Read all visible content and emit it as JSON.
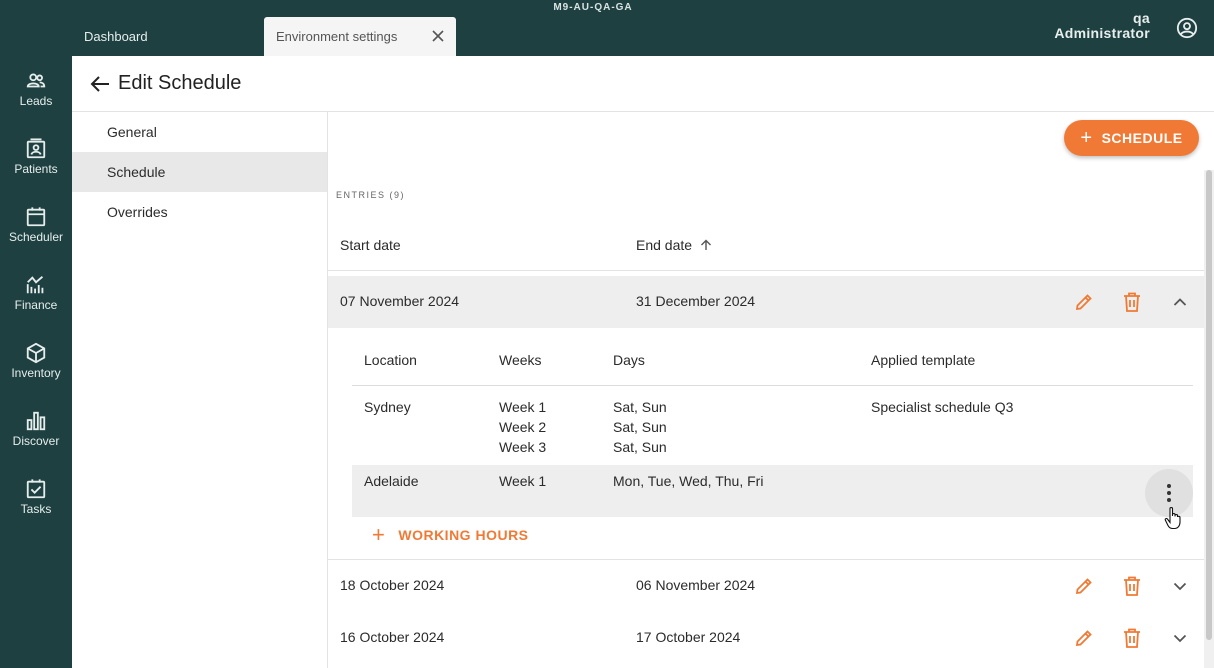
{
  "topbar": {
    "env_code": "M9-AU-QA-GA",
    "tabs": [
      {
        "label": "Dashboard"
      },
      {
        "label": "Environment settings"
      }
    ],
    "user": {
      "line1": "qa",
      "line2": "Administrator"
    },
    "icons": {
      "close": "close-icon",
      "user": "user-circle-icon"
    }
  },
  "sidebar": {
    "items": [
      {
        "label": "Leads",
        "icon": "people-icon"
      },
      {
        "label": "Patients",
        "icon": "contact-card-icon"
      },
      {
        "label": "Scheduler",
        "icon": "calendar-icon"
      },
      {
        "label": "Finance",
        "icon": "chart-line-icon"
      },
      {
        "label": "Inventory",
        "icon": "box-icon"
      },
      {
        "label": "Discover",
        "icon": "bar-chart-icon"
      },
      {
        "label": "Tasks",
        "icon": "task-check-icon"
      }
    ]
  },
  "header": {
    "title": "Edit Schedule",
    "back_icon": "arrow-left-icon"
  },
  "left_menu": {
    "items": [
      {
        "label": "General",
        "active": false
      },
      {
        "label": "Schedule",
        "active": true
      },
      {
        "label": "Overrides",
        "active": false
      }
    ]
  },
  "main": {
    "add_button": {
      "plus": "+",
      "label": "SCHEDULE"
    },
    "entries_label": "ENTRIES (9)",
    "columns": {
      "start": "Start date",
      "end": "End date"
    },
    "rows": [
      {
        "start": "07 November 2024",
        "end": "31 December 2024",
        "expanded": true
      },
      {
        "start": "18 October 2024",
        "end": "06 November 2024",
        "expanded": false
      },
      {
        "start": "16 October 2024",
        "end": "17 October 2024",
        "expanded": false
      }
    ],
    "detail": {
      "headers": {
        "location": "Location",
        "weeks": "Weeks",
        "days": "Days",
        "template": "Applied template"
      },
      "rows": [
        {
          "location": "Sydney",
          "weeks": [
            "Week 1",
            "Week 2",
            "Week 3"
          ],
          "days": [
            "Sat, Sun",
            "Sat, Sun",
            "Sat, Sun"
          ],
          "template": "Specialist schedule Q3"
        },
        {
          "location": "Adelaide",
          "weeks": [
            "Week 1"
          ],
          "days": [
            "Mon, Tue, Wed, Thu, Fri"
          ],
          "template": ""
        }
      ],
      "add_working_hours": {
        "plus": "+",
        "label": "WORKING HOURS"
      }
    }
  },
  "colors": {
    "brand_dark": "#1e4040",
    "accent": "#f07a35",
    "row_highlight": "#eeeeee"
  }
}
